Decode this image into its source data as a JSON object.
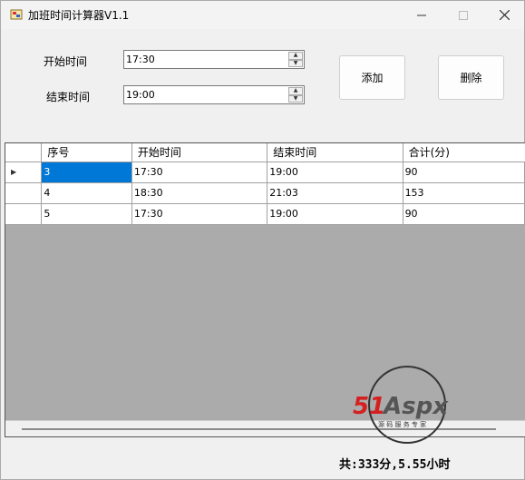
{
  "window": {
    "title": "加班时间计算器V1.1"
  },
  "form": {
    "start_label": "开始时间",
    "start_value": "17:30",
    "end_label": "结束时间",
    "end_value": "19:00",
    "add_label": "添加",
    "delete_label": "删除"
  },
  "grid": {
    "columns": [
      "序号",
      "开始时间",
      "结束时间",
      "合计(分)"
    ],
    "rows": [
      [
        "3",
        "17:30",
        "19:00",
        "90"
      ],
      [
        "4",
        "18:30",
        "21:03",
        "153"
      ],
      [
        "5",
        "17:30",
        "19:00",
        "90"
      ]
    ]
  },
  "watermark": {
    "brand": "51Aspx",
    "tagline": "源 码 服 务 专 家"
  },
  "summary": "共:333分,5.55小时"
}
